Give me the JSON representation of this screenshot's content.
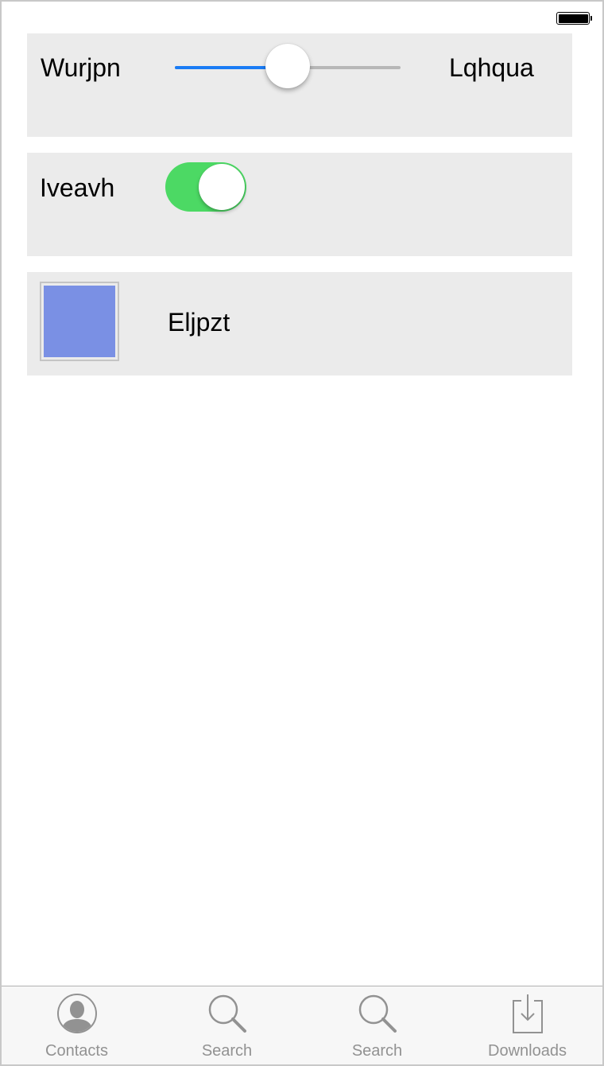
{
  "status_bar": {
    "battery_icon": "battery-full-icon"
  },
  "slider_row": {
    "left_label": "Wurjpn",
    "right_label": "Lqhqua",
    "value": 0.5,
    "track_color": "#b7b7b7",
    "fill_color": "#1a7cf5"
  },
  "toggle_row": {
    "label": "Iveavh",
    "on": true,
    "on_color": "#4cd964"
  },
  "color_row": {
    "label": "Eljpzt",
    "swatch_color": "#7a90e4"
  },
  "tab_bar": {
    "items": [
      {
        "label": "Contacts",
        "icon": "contacts-icon"
      },
      {
        "label": "Search",
        "icon": "search-icon"
      },
      {
        "label": "Search",
        "icon": "search-icon"
      },
      {
        "label": "Downloads",
        "icon": "downloads-icon"
      }
    ]
  }
}
